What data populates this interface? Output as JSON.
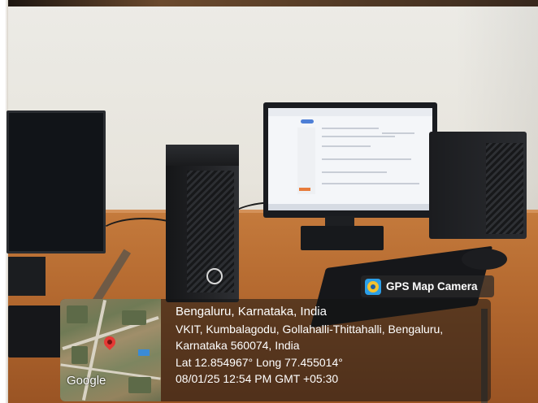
{
  "badge": {
    "app_name": "GPS Map Camera",
    "icon": "gps-map-camera-icon"
  },
  "location": {
    "city_line": "Bengaluru, Karnataka, India",
    "address_line1": "VKIT, Kumbalagodu, Gollahalli-Thittahalli, Bengaluru,",
    "address_line2": "Karnataka 560074, India",
    "coordinates": "Lat 12.854967° Long 77.455014°",
    "datetime": "08/01/25 12:54 PM GMT +05:30"
  },
  "map": {
    "provider_logo": "Google",
    "pin_icon": "map-pin-icon"
  },
  "scene": {
    "objects": [
      "left-monitor",
      "desktop-tower",
      "center-monitor",
      "right-desktop-tower",
      "keyboard",
      "mouse",
      "desk"
    ],
    "colors": {
      "desk": "#b56a30",
      "wall": "#e9e7e1",
      "pin": "#e53935"
    }
  }
}
